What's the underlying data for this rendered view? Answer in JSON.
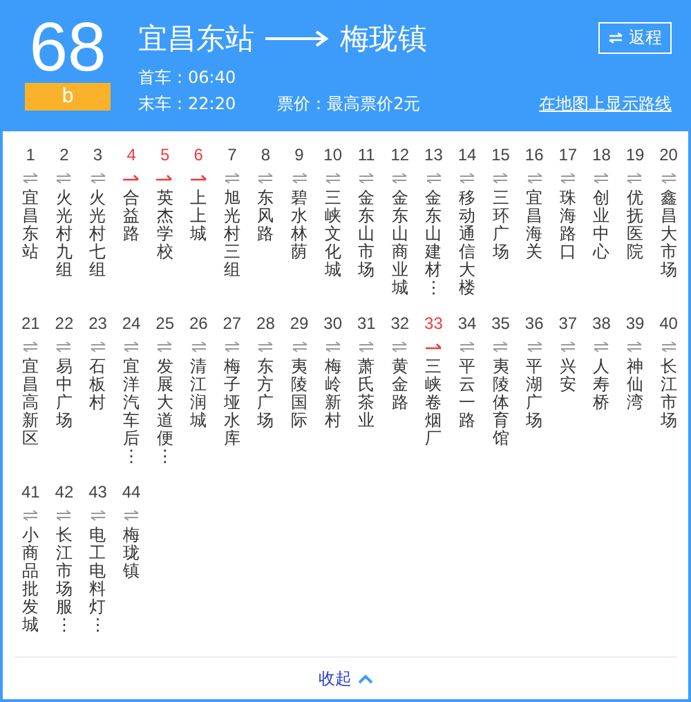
{
  "header": {
    "route_number": "68",
    "route_variant": "b",
    "origin": "宜昌东站",
    "destination": "梅珑镇",
    "return_button": "返程",
    "first_bus": "首车：06:40",
    "last_bus": "末车：22:20",
    "fare": "票价：最高票价2元",
    "map_link": "在地图上显示路线"
  },
  "stops": [
    {
      "number": "1",
      "name": "宜昌东站",
      "one_way": false
    },
    {
      "number": "2",
      "name": "火光村九组",
      "one_way": false
    },
    {
      "number": "3",
      "name": "火光村七组",
      "one_way": false
    },
    {
      "number": "4",
      "name": "合益路",
      "one_way": true
    },
    {
      "number": "5",
      "name": "英杰学校",
      "one_way": true
    },
    {
      "number": "6",
      "name": "上上城",
      "one_way": true
    },
    {
      "number": "7",
      "name": "旭光村三组",
      "one_way": false
    },
    {
      "number": "8",
      "name": "东风路",
      "one_way": false
    },
    {
      "number": "9",
      "name": "碧水林荫",
      "one_way": false
    },
    {
      "number": "10",
      "name": "三峡文化城",
      "one_way": false
    },
    {
      "number": "11",
      "name": "金东山市场",
      "one_way": false
    },
    {
      "number": "12",
      "name": "金东山商业城",
      "one_way": false
    },
    {
      "number": "13",
      "name": "金东山建材⋮",
      "one_way": false
    },
    {
      "number": "14",
      "name": "移动通信大楼",
      "one_way": false
    },
    {
      "number": "15",
      "name": "三环广场",
      "one_way": false
    },
    {
      "number": "16",
      "name": "宜昌海关",
      "one_way": false
    },
    {
      "number": "17",
      "name": "珠海路口",
      "one_way": false
    },
    {
      "number": "18",
      "name": "创业中心",
      "one_way": false
    },
    {
      "number": "19",
      "name": "优抚医院",
      "one_way": false
    },
    {
      "number": "20",
      "name": "鑫昌大市场",
      "one_way": false
    },
    {
      "number": "21",
      "name": "宜昌高新区",
      "one_way": false
    },
    {
      "number": "22",
      "name": "易中广场",
      "one_way": false
    },
    {
      "number": "23",
      "name": "石板村",
      "one_way": false
    },
    {
      "number": "24",
      "name": "宜洋汽车后⋮",
      "one_way": false
    },
    {
      "number": "25",
      "name": "发展大道便⋮",
      "one_way": false
    },
    {
      "number": "26",
      "name": "清江润城",
      "one_way": false
    },
    {
      "number": "27",
      "name": "梅子垭水库",
      "one_way": false
    },
    {
      "number": "28",
      "name": "东方广场",
      "one_way": false
    },
    {
      "number": "29",
      "name": "夷陵国际",
      "one_way": false
    },
    {
      "number": "30",
      "name": "梅岭新村",
      "one_way": false
    },
    {
      "number": "31",
      "name": "萧氏茶业",
      "one_way": false
    },
    {
      "number": "32",
      "name": "黄金路",
      "one_way": false
    },
    {
      "number": "33",
      "name": "三峡卷烟厂",
      "one_way": true
    },
    {
      "number": "34",
      "name": "平云一路",
      "one_way": false
    },
    {
      "number": "35",
      "name": "夷陵体育馆",
      "one_way": false
    },
    {
      "number": "36",
      "name": "平湖广场",
      "one_way": false
    },
    {
      "number": "37",
      "name": "兴安",
      "one_way": false
    },
    {
      "number": "38",
      "name": "人寿桥",
      "one_way": false
    },
    {
      "number": "39",
      "name": "神仙湾",
      "one_way": false
    },
    {
      "number": "40",
      "name": "长江市场",
      "one_way": false
    },
    {
      "number": "41",
      "name": "小商品批发城",
      "one_way": false
    },
    {
      "number": "42",
      "name": "长江市场服⋮",
      "one_way": false
    },
    {
      "number": "43",
      "name": "电工电料灯⋮",
      "one_way": false
    },
    {
      "number": "44",
      "name": "梅珑镇",
      "one_way": false
    }
  ],
  "collapse_link": "收起"
}
